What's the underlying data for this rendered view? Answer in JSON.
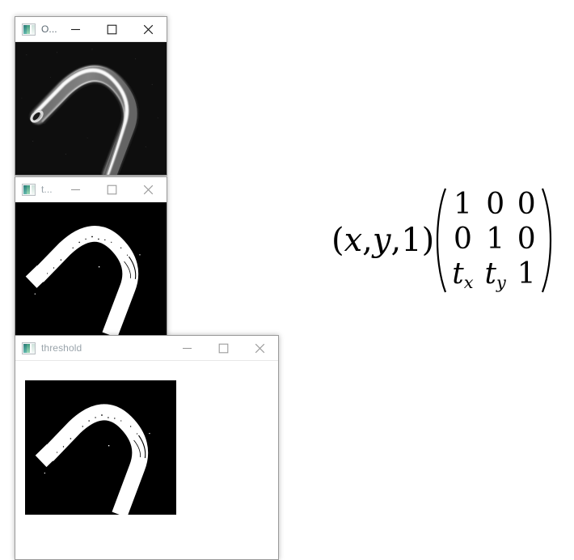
{
  "windows": [
    {
      "id": "original",
      "title": "O...",
      "full_title_hint": "O...",
      "active": true,
      "icon": "image-viewer-icon",
      "controls": {
        "minimize": "—",
        "maximize": "□",
        "close": "✕"
      },
      "content_type": "grayscale-photo",
      "content_description": "Grayscale photograph of a bent metal hook on a black background"
    },
    {
      "id": "threshold-small",
      "title": "t...",
      "full_title_hint": "t...",
      "active": false,
      "icon": "image-viewer-icon",
      "controls": {
        "minimize": "—",
        "maximize": "□",
        "close": "✕"
      },
      "content_type": "binary-image",
      "content_description": "Binary thresholded image of the bent metal hook, white on black"
    },
    {
      "id": "threshold",
      "title": "threshold",
      "full_title_hint": "threshold",
      "active": false,
      "icon": "image-viewer-icon",
      "controls": {
        "minimize": "—",
        "maximize": "□",
        "close": "✕"
      },
      "content_type": "binary-image",
      "content_description": "Binary thresholded image of the bent metal hook, white on black"
    }
  ],
  "equation": {
    "name": "translation-matrix-equation",
    "latex": "(x, y, 1) \\begin{pmatrix} 1 & 0 & 0 \\\\ 0 & 1 & 0 \\\\ t_x & t_y & 1 \\end{pmatrix}",
    "row_vector": {
      "open": "(",
      "items": [
        "x",
        ",",
        "y",
        ",",
        "1"
      ],
      "close": ")",
      "text": "(x, y, 1)"
    },
    "matrix": {
      "rows": [
        [
          "1",
          "0",
          "0"
        ],
        [
          "0",
          "1",
          "0"
        ],
        [
          "t_x",
          "t_y",
          "1"
        ]
      ],
      "display_rows": [
        [
          "1",
          "0",
          "0"
        ],
        [
          "0",
          "1",
          "0"
        ],
        [
          "tx",
          "ty",
          "1"
        ]
      ]
    }
  },
  "colors": {
    "background": "#ffffff",
    "window_border": "#9a9a9a",
    "titlebar": "#ffffff",
    "title_active": "#5e6b74",
    "title_inactive": "#9aa4ab",
    "control_active": "#1c1c1c",
    "control_inactive": "#9a9a9a",
    "image_background": "#000000",
    "icon_teal": "#3f9a7f"
  }
}
